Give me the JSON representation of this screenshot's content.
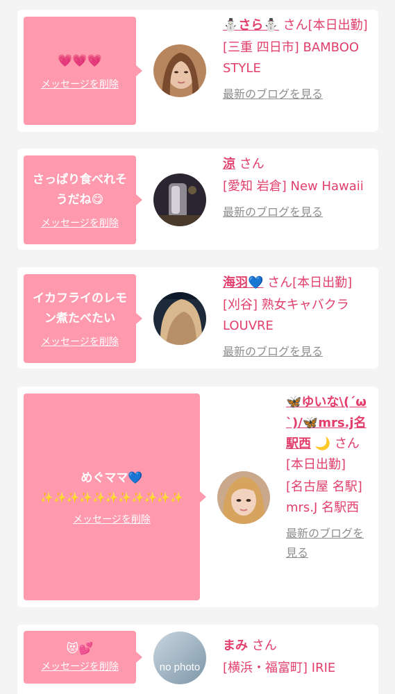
{
  "messages": [
    {
      "text": "💗💗💗",
      "delete_label": "メッセージを削除",
      "name": "⛄さら⛄",
      "honorific": "さん",
      "status": "[本日出勤]",
      "shop": "[三重 四日市] BAMBOO STYLE",
      "blog_link": "最新のブログを見る"
    },
    {
      "text": "さっぱり食べれそうだね😋",
      "delete_label": "メッセージを削除",
      "name": "涼",
      "honorific": "さん",
      "status": "",
      "shop": "[愛知 岩倉] New Hawaii",
      "blog_link": "最新のブログを見る"
    },
    {
      "text": "イカフライのレモン煮たべたい",
      "delete_label": "メッセージを削除",
      "name": "海羽💙",
      "honorific": "さん",
      "status": "[本日出勤]",
      "shop": "[刈谷] 熟女キャバクラLOUVRE",
      "blog_link": "最新のブログを見る"
    },
    {
      "text": "めぐママ💙",
      "sparkles": "✨✨✨✨✨✨✨✨✨✨✨",
      "delete_label": "メッセージを削除",
      "name": "🦋ゆいな\\(´ω`)/🦋mrs.j名駅西",
      "name_suffix": "🌙",
      "honorific": "さん",
      "status": "[本日出勤]",
      "shop": "[名古屋 名駅] mrs.J 名駅西",
      "blog_link": "最新のブログを見る"
    },
    {
      "text": "😻💕",
      "delete_label": "メッセージを削除",
      "name": "まみ",
      "honorific": "さん",
      "status": "",
      "shop": "[横浜・福富町] IRIE",
      "avatar_text": "no photo"
    }
  ],
  "colors": {
    "bubble": "#ff9aae",
    "accent_text": "#e23e6b",
    "link_gray": "#8e8e8e",
    "background": "#f4f4f4"
  }
}
